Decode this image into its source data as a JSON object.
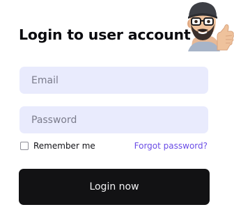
{
  "login": {
    "title": "Login to user account",
    "email_placeholder": "Email",
    "password_placeholder": "Password",
    "remember_label": "Remember me",
    "forgot_label": "Forgot password?",
    "submit_label": "Login now"
  },
  "icons": {
    "avatar": "memoji-thumbs-up-avatar"
  },
  "colors": {
    "field_background": "#e9ebfd",
    "link": "#6a4ce6",
    "button_background": "#121214",
    "button_text": "#f2f2f4",
    "title_text": "#0b0b0f"
  }
}
